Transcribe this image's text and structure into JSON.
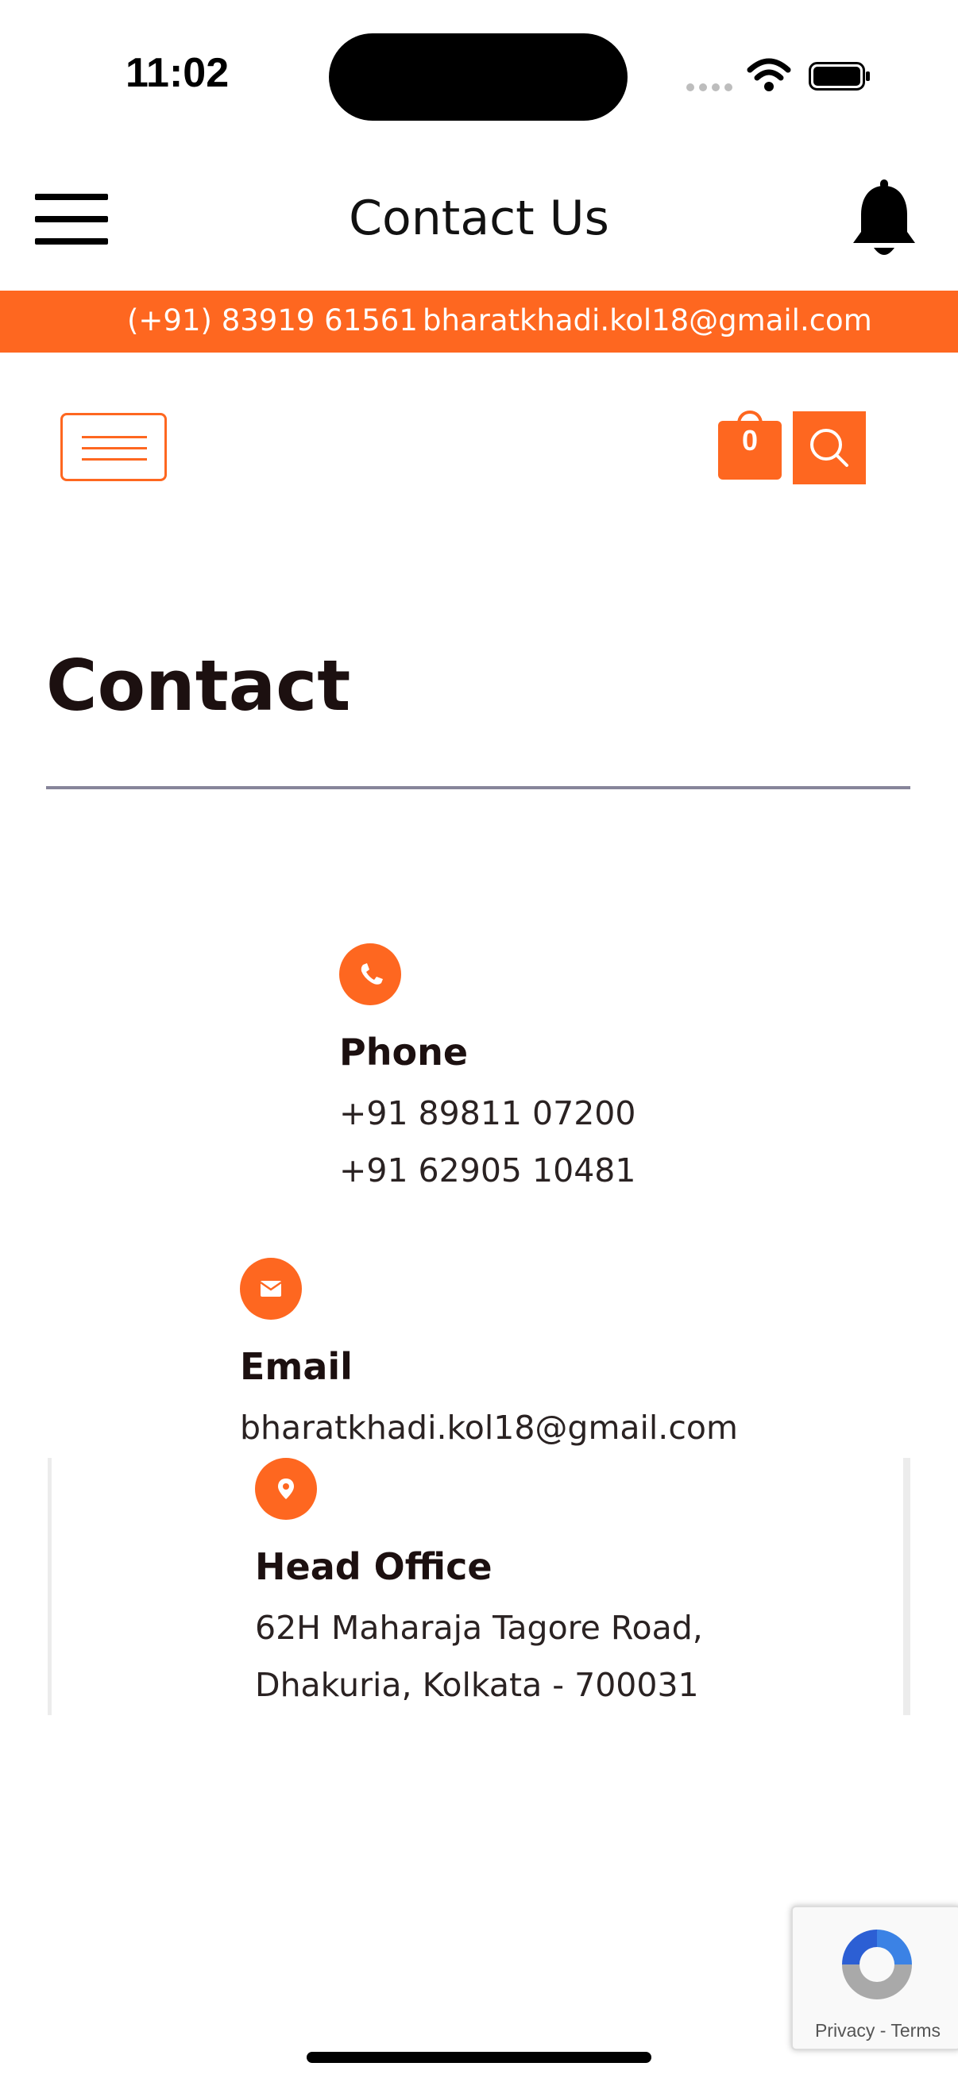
{
  "status_bar": {
    "time": "11:02",
    "icons": [
      "cellular-signal-icon",
      "wifi-icon",
      "battery-icon"
    ]
  },
  "header": {
    "title": "Contact Us",
    "icons": [
      "hamburger-menu-icon",
      "bell-icon"
    ]
  },
  "topbar": {
    "phone": "(+91) 83919 61561",
    "email": "bharatkhadi.kol18@gmail.com",
    "background": "#fe6720"
  },
  "site_nav": {
    "cart_count": "0",
    "icons": [
      "site-menu-icon",
      "shopping-bag-icon",
      "search-icon"
    ]
  },
  "page": {
    "heading": "Contact"
  },
  "contact": {
    "phone": {
      "title": "Phone",
      "lines": [
        "+91 89811 07200",
        "+91 62905 10481"
      ],
      "icon": "phone-icon"
    },
    "email": {
      "title": "Email",
      "lines": [
        "bharatkhadi.kol18@gmail.com"
      ],
      "icon": "envelope-icon"
    },
    "office": {
      "title": "Head Office",
      "lines": [
        "62H Maharaja Tagore Road,",
        "Dhakuria, Kolkata - 700031"
      ],
      "icon": "map-pin-icon"
    }
  },
  "recaptcha": {
    "links": "Privacy - Terms",
    "icon": "recaptcha-logo-icon"
  },
  "colors": {
    "accent": "#fe6720",
    "heading_text": "#1c1010",
    "rule": "#87859a"
  }
}
